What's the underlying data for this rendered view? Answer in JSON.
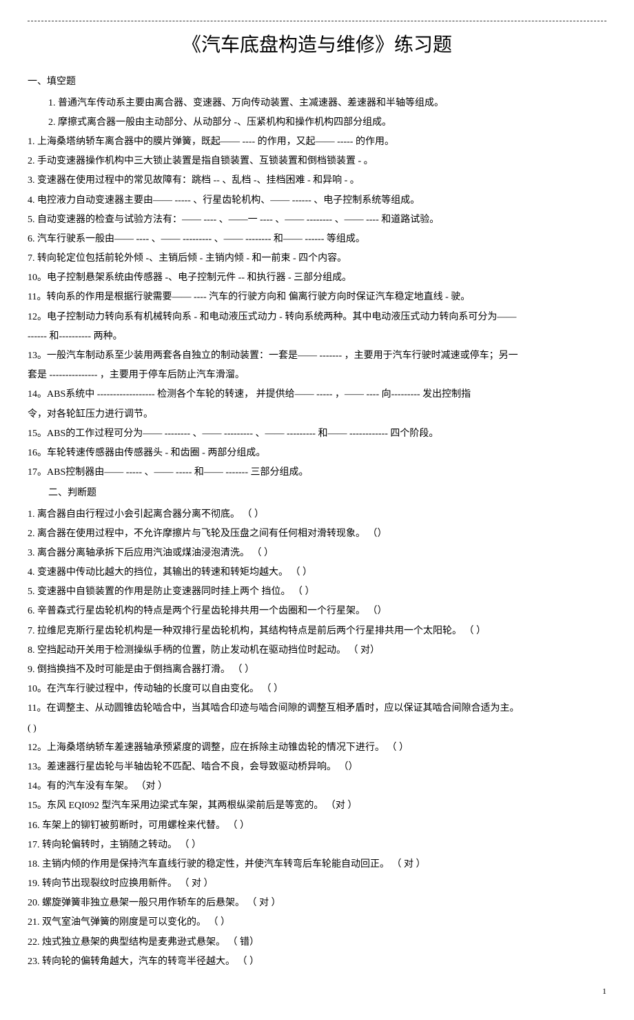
{
  "title": "《汽车底盘构造与维修》练习题",
  "section1": {
    "heading": "一、填空题",
    "items": [
      "1.   普通汽车传动系主要由离合器、变速器、万向传动装置、主减速器、差速器和半轴等组成。",
      "2.   摩擦式离合器一般由主动部分、从动部分    -、压紧机构和操作机构四部分组成。",
      "1.   上海桑塔纳轿车离合器中的膜片弹簧，既起——    ----  的作用，又起—— ----- 的作用。",
      "2.   手动变速器操作机构中三大锁止装置是指自锁装置、互锁装置和倒档锁装置        - 。",
      "3.   变速器在使用过程中的常见故障有：跳档    -- 、乱档 -、挂档困难  - 和异响 - 。",
      "4.   电控液力自动变速器主要由——    -----  、行星齿轮机构、—— ------ 、电子控制系统等组成。",
      "5.   自动变速器的检查与试验方法有：——    ----  、——一 ----  、—— --------   、—— ---- 和道路试验。",
      "6.   汽车行驶系一般由——  ----  、—— ---------   、—— --------   和—— ------   等组成。",
      "7.   转向轮定位包括前轮外倾   -、主销后倾  - 主销内倾  - 和一前束  - 四个内容。",
      "10。电子控制悬架系统由传感器   -、电子控制元件  --  和执行器  - 三部分组成。",
      "11。转向系的作用是根据行驶需要——    ----  汽车的行驶方向和    偏离行驶方向时保证汽车稳定地直线    - 驶。",
      "12。电子控制动力转向系有机械转向系     - 和电动液压式动力   - 转向系统两种。其中电动液压式动力转向系可分为——",
      "------   和----------      两种。",
      "13。一般汽车制动系至少装用两套各自独立的制动装置：一套是——     -------   ，主要用于汽车行驶时减速或停车；另一",
      "套是 ---------------      ，主要用于停车后防止汽车滑溜。",
      "14。ABS系统中 ------------------        检测各个车轮的转速，  并提供给—— -----  ，—— ----  向---------      发出控制指",
      "令，对各轮缸压力进行调节。",
      "15。ABS的工作过程可分为——   --------   、—— ---------   、—— ---------   和—— ------------    四个阶段。",
      "16。车轮转速传感器由传感器头    - 和齿圈 - 两部分组成。",
      "17。ABS控制器由——  -----  、—— -----   和—— -------   三部分组成。"
    ]
  },
  "section2": {
    "heading": "二、判断题",
    "items": [
      "1.   离合器自由行程过小会引起离合器分离不彻底。    （ ）",
      "2.   离合器在使用过程中，不允许摩擦片与飞轮及压盘之间有任何相对滑转现象。          （）",
      "3.   离合器分离轴承拆下后应用汽油或煤油浸泡清洗。       （  ）",
      "4.   变速器中传动比越大的挡位，其输出的转速和转矩均越大。         （  ）",
      "5.   变速器中自锁装置的作用是防止变速器同时挂上两个       挡位。  （  ）",
      "6.   辛普森式行星齿轮机构的特点是两个行星齿轮排共用一个齿圈和一个行星架。           （）",
      "7.   拉维尼克斯行星齿轮机构是一种双排行星齿轮机构，其结构特点是前后两个行星排共用一个太阳轮。              （  ）",
      "8.   空挡起动开关用于检测操纵手柄的位置，防止发动机在驱动挡位时起动。          （    对）",
      "9.   倒挡换挡不及时可能是由于倒挡离合器打滑。      （  ）",
      "10。在汽车行驶过程中，传动轴的长度可以自由变化。        （  ）",
      "11。在调整主、从动圆锥齿轮啮合中，当其啮合印迹与啮合间隙的调整互相矛盾时，应以保证其啮合间隙合适为主。",
      "(   )",
      "12。上海桑塔纳轿车差速器轴承预紧度的调整，应在拆除主动锥齿轮的情况下进行。             （  ）",
      "13。差速器行星齿轮与半轴齿轮不匹配、啮合不良，会导致驱动桥异响。          （）",
      "14。有的汽车没有车架。        （对   ）",
      "15。东风 EQI092 型汽车采用边梁式车架，其两根纵梁前后是等宽的。         （对     ）",
      "16.  车架上的铆钉被剪断时，可用螺栓来代替。      （  ）",
      "17.  转向轮偏转时，主销随之转动。     （  ）",
      "18.  主销内倾的作用是保持汽车直线行驶的稳定性，并使汽车转弯后车轮能自动回正。             （    对  ）",
      "19.  转向节出现裂纹时应换用新件。     （    对 ）",
      "20.  螺旋弹簧非独立悬架一般只用作轿车的后悬架。       （    对 ）",
      "21.  双气室油气弹簧的刚度是可以变化的。     （  ）",
      "22.  烛式独立悬架的典型结构是麦弗逊式悬架。       （     错）",
      "23.  转向轮的偏转角越大，汽车的转弯半径越大。      （  ）"
    ]
  },
  "pageNumber": "1"
}
